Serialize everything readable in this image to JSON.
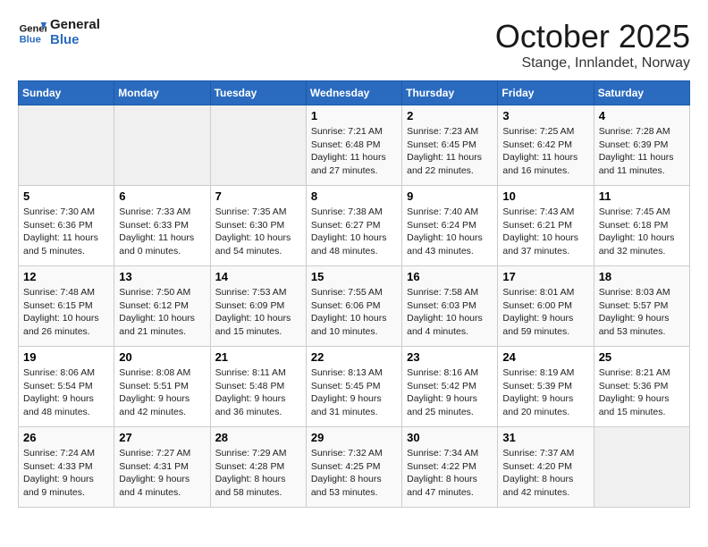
{
  "header": {
    "logo_line1": "General",
    "logo_line2": "Blue",
    "month": "October 2025",
    "location": "Stange, Innlandet, Norway"
  },
  "weekdays": [
    "Sunday",
    "Monday",
    "Tuesday",
    "Wednesday",
    "Thursday",
    "Friday",
    "Saturday"
  ],
  "weeks": [
    [
      {
        "day": "",
        "info": ""
      },
      {
        "day": "",
        "info": ""
      },
      {
        "day": "",
        "info": ""
      },
      {
        "day": "1",
        "info": "Sunrise: 7:21 AM\nSunset: 6:48 PM\nDaylight: 11 hours\nand 27 minutes."
      },
      {
        "day": "2",
        "info": "Sunrise: 7:23 AM\nSunset: 6:45 PM\nDaylight: 11 hours\nand 22 minutes."
      },
      {
        "day": "3",
        "info": "Sunrise: 7:25 AM\nSunset: 6:42 PM\nDaylight: 11 hours\nand 16 minutes."
      },
      {
        "day": "4",
        "info": "Sunrise: 7:28 AM\nSunset: 6:39 PM\nDaylight: 11 hours\nand 11 minutes."
      }
    ],
    [
      {
        "day": "5",
        "info": "Sunrise: 7:30 AM\nSunset: 6:36 PM\nDaylight: 11 hours\nand 5 minutes."
      },
      {
        "day": "6",
        "info": "Sunrise: 7:33 AM\nSunset: 6:33 PM\nDaylight: 11 hours\nand 0 minutes."
      },
      {
        "day": "7",
        "info": "Sunrise: 7:35 AM\nSunset: 6:30 PM\nDaylight: 10 hours\nand 54 minutes."
      },
      {
        "day": "8",
        "info": "Sunrise: 7:38 AM\nSunset: 6:27 PM\nDaylight: 10 hours\nand 48 minutes."
      },
      {
        "day": "9",
        "info": "Sunrise: 7:40 AM\nSunset: 6:24 PM\nDaylight: 10 hours\nand 43 minutes."
      },
      {
        "day": "10",
        "info": "Sunrise: 7:43 AM\nSunset: 6:21 PM\nDaylight: 10 hours\nand 37 minutes."
      },
      {
        "day": "11",
        "info": "Sunrise: 7:45 AM\nSunset: 6:18 PM\nDaylight: 10 hours\nand 32 minutes."
      }
    ],
    [
      {
        "day": "12",
        "info": "Sunrise: 7:48 AM\nSunset: 6:15 PM\nDaylight: 10 hours\nand 26 minutes."
      },
      {
        "day": "13",
        "info": "Sunrise: 7:50 AM\nSunset: 6:12 PM\nDaylight: 10 hours\nand 21 minutes."
      },
      {
        "day": "14",
        "info": "Sunrise: 7:53 AM\nSunset: 6:09 PM\nDaylight: 10 hours\nand 15 minutes."
      },
      {
        "day": "15",
        "info": "Sunrise: 7:55 AM\nSunset: 6:06 PM\nDaylight: 10 hours\nand 10 minutes."
      },
      {
        "day": "16",
        "info": "Sunrise: 7:58 AM\nSunset: 6:03 PM\nDaylight: 10 hours\nand 4 minutes."
      },
      {
        "day": "17",
        "info": "Sunrise: 8:01 AM\nSunset: 6:00 PM\nDaylight: 9 hours\nand 59 minutes."
      },
      {
        "day": "18",
        "info": "Sunrise: 8:03 AM\nSunset: 5:57 PM\nDaylight: 9 hours\nand 53 minutes."
      }
    ],
    [
      {
        "day": "19",
        "info": "Sunrise: 8:06 AM\nSunset: 5:54 PM\nDaylight: 9 hours\nand 48 minutes."
      },
      {
        "day": "20",
        "info": "Sunrise: 8:08 AM\nSunset: 5:51 PM\nDaylight: 9 hours\nand 42 minutes."
      },
      {
        "day": "21",
        "info": "Sunrise: 8:11 AM\nSunset: 5:48 PM\nDaylight: 9 hours\nand 36 minutes."
      },
      {
        "day": "22",
        "info": "Sunrise: 8:13 AM\nSunset: 5:45 PM\nDaylight: 9 hours\nand 31 minutes."
      },
      {
        "day": "23",
        "info": "Sunrise: 8:16 AM\nSunset: 5:42 PM\nDaylight: 9 hours\nand 25 minutes."
      },
      {
        "day": "24",
        "info": "Sunrise: 8:19 AM\nSunset: 5:39 PM\nDaylight: 9 hours\nand 20 minutes."
      },
      {
        "day": "25",
        "info": "Sunrise: 8:21 AM\nSunset: 5:36 PM\nDaylight: 9 hours\nand 15 minutes."
      }
    ],
    [
      {
        "day": "26",
        "info": "Sunrise: 7:24 AM\nSunset: 4:33 PM\nDaylight: 9 hours\nand 9 minutes."
      },
      {
        "day": "27",
        "info": "Sunrise: 7:27 AM\nSunset: 4:31 PM\nDaylight: 9 hours\nand 4 minutes."
      },
      {
        "day": "28",
        "info": "Sunrise: 7:29 AM\nSunset: 4:28 PM\nDaylight: 8 hours\nand 58 minutes."
      },
      {
        "day": "29",
        "info": "Sunrise: 7:32 AM\nSunset: 4:25 PM\nDaylight: 8 hours\nand 53 minutes."
      },
      {
        "day": "30",
        "info": "Sunrise: 7:34 AM\nSunset: 4:22 PM\nDaylight: 8 hours\nand 47 minutes."
      },
      {
        "day": "31",
        "info": "Sunrise: 7:37 AM\nSunset: 4:20 PM\nDaylight: 8 hours\nand 42 minutes."
      },
      {
        "day": "",
        "info": ""
      }
    ]
  ]
}
